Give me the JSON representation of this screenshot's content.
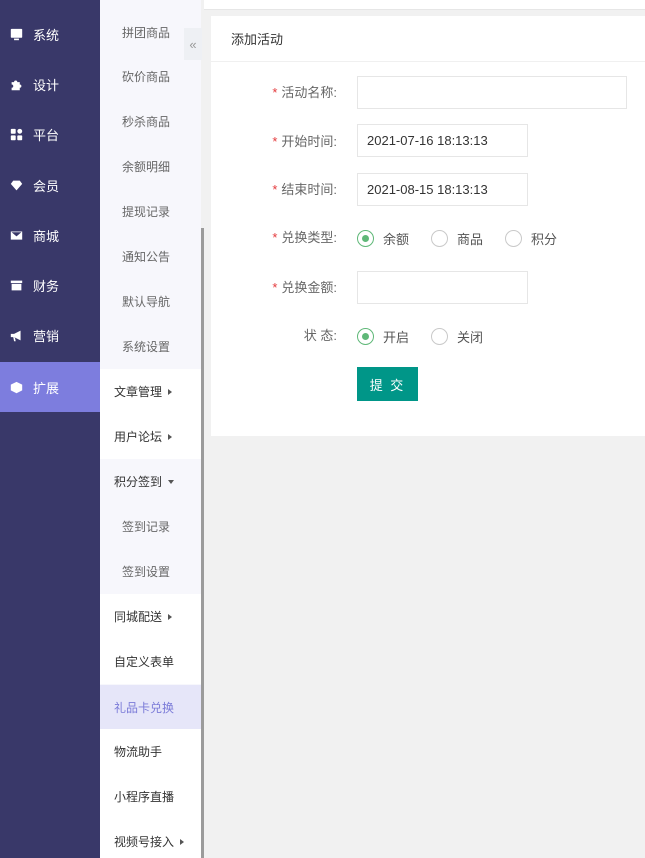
{
  "sidebar_main": {
    "items": [
      {
        "label": "系统",
        "icon": "monitor-icon"
      },
      {
        "label": "设计",
        "icon": "puzzle-icon"
      },
      {
        "label": "平台",
        "icon": "grid-icon"
      },
      {
        "label": "会员",
        "icon": "gem-icon"
      },
      {
        "label": "商城",
        "icon": "mail-icon"
      },
      {
        "label": "财务",
        "icon": "wallet-icon"
      },
      {
        "label": "营销",
        "icon": "megaphone-icon"
      },
      {
        "label": "扩展",
        "icon": "cube-icon",
        "active": true
      }
    ]
  },
  "sidebar_sub": {
    "collapse_glyph": "«",
    "items": [
      {
        "label": "拼团商品"
      },
      {
        "label": "砍价商品"
      },
      {
        "label": "秒杀商品"
      },
      {
        "label": "余额明细"
      },
      {
        "label": "提现记录"
      },
      {
        "label": "通知公告"
      },
      {
        "label": "默认导航"
      },
      {
        "label": "系统设置"
      },
      {
        "label": "文章管理"
      },
      {
        "label": "用户论坛"
      },
      {
        "label": "积分签到"
      },
      {
        "label": "签到记录"
      },
      {
        "label": "签到设置"
      },
      {
        "label": "同城配送"
      },
      {
        "label": "自定义表单"
      },
      {
        "label": "礼品卡兑换",
        "active": true
      },
      {
        "label": "物流助手"
      },
      {
        "label": "小程序直播"
      },
      {
        "label": "视频号接入"
      }
    ]
  },
  "card": {
    "title": "添加活动",
    "required_mark": "*",
    "fields": {
      "name": {
        "label": "活动名称:",
        "value": ""
      },
      "start": {
        "label": "开始时间:",
        "value": "2021-07-16 18:13:13"
      },
      "end": {
        "label": "结束时间:",
        "value": "2021-08-15 18:13:13"
      },
      "type": {
        "label": "兑换类型:",
        "options": [
          "余额",
          "商品",
          "积分"
        ],
        "selected": "余额"
      },
      "amount": {
        "label": "兑换金额:",
        "value": ""
      },
      "status": {
        "label": "状 态:",
        "options": [
          "开启",
          "关闭"
        ],
        "selected": "开启"
      }
    },
    "submit_label": "提 交"
  },
  "colors": {
    "sidebar_bg": "#393869",
    "sidebar_active": "#7d7dde",
    "submit_bg": "#009688",
    "radio_on": "#5fb878",
    "required": "#e4393c"
  }
}
